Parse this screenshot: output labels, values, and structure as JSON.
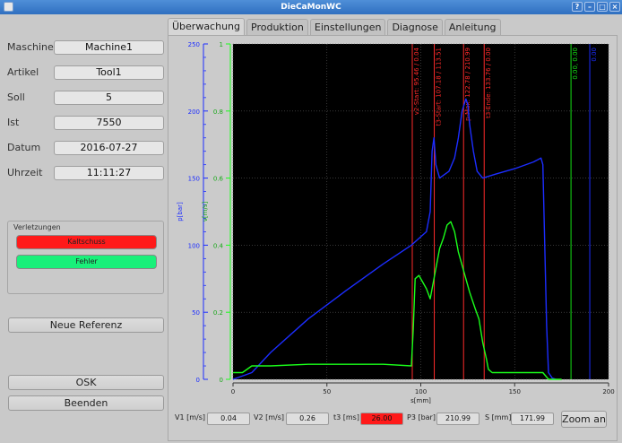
{
  "window": {
    "title": "DieCaMonWC",
    "buttons": [
      "?",
      "–",
      "□",
      "×"
    ]
  },
  "fields": [
    {
      "label": "Maschine",
      "value": "Machine1"
    },
    {
      "label": "Artikel",
      "value": "Tool1"
    },
    {
      "label": "Soll",
      "value": "5"
    },
    {
      "label": "Ist",
      "value": "7550"
    },
    {
      "label": "Datum",
      "value": "2016-07-27"
    },
    {
      "label": "Uhrzeit",
      "value": "11:11:27"
    }
  ],
  "violations": {
    "title": "Verletzungen",
    "items": [
      {
        "label": "Kaltschuss",
        "color": "#ff1a1a"
      },
      {
        "label": "Fehler",
        "color": "#19f07a"
      }
    ]
  },
  "buttons": {
    "reference": "Neue Referenz",
    "osk": "OSK",
    "quit": "Beenden",
    "zoom": "Zoom an"
  },
  "tabs": [
    {
      "label": "Überwachung",
      "active": true
    },
    {
      "label": "Produktion",
      "active": false
    },
    {
      "label": "Einstellungen",
      "active": false
    },
    {
      "label": "Diagnose",
      "active": false
    },
    {
      "label": "Anleitung",
      "active": false
    }
  ],
  "measurements": [
    {
      "label": "V1 [m/s]",
      "value": "0.04",
      "highlight": false
    },
    {
      "label": "V2 [m/s]",
      "value": "0.26",
      "highlight": false
    },
    {
      "label": "t3 [ms]",
      "value": "26.00",
      "highlight": true
    },
    {
      "label": "P3 [bar]",
      "value": "210.99",
      "highlight": false
    },
    {
      "label": "S [mm]",
      "value": "171.99",
      "highlight": false
    }
  ],
  "chart_data": {
    "type": "line",
    "background": "#000000",
    "xlabel": "s[mm]",
    "ylabel_left": "p[bar]",
    "ylabel_right": "v[m/s]",
    "xlim": [
      0,
      200
    ],
    "ylim_left": [
      0,
      250
    ],
    "ylim_right": [
      0,
      1
    ],
    "xticks": [
      "0",
      "50",
      "100",
      "150",
      "200"
    ],
    "yticks_left": [
      "0",
      "50",
      "100",
      "150",
      "200",
      "250"
    ],
    "yticks_right": [
      "0",
      "0.2",
      "0.4",
      "0.6",
      "0.8",
      "1"
    ],
    "grid": true,
    "series": [
      {
        "axis": "left",
        "color": "#1c2dff",
        "x": [
          0,
          10,
          20,
          40,
          60,
          80,
          95,
          103,
          105,
          106,
          107,
          108,
          109,
          110,
          112,
          115,
          118,
          120,
          122,
          124,
          125,
          126,
          128,
          130,
          133,
          140,
          150,
          160,
          164,
          165,
          166,
          167,
          168,
          170,
          172
        ],
        "y": [
          0,
          5,
          20,
          45,
          66,
          86,
          100,
          110,
          125,
          170,
          180,
          160,
          155,
          150,
          152,
          155,
          165,
          180,
          200,
          209,
          205,
          190,
          170,
          155,
          150,
          153,
          157,
          162,
          165,
          160,
          100,
          40,
          5,
          1,
          0
        ]
      },
      {
        "axis": "right",
        "color": "#1aff1a",
        "x": [
          0,
          5,
          10,
          20,
          40,
          60,
          80,
          95,
          96,
          97,
          99,
          101,
          103,
          105,
          107,
          110,
          112,
          114,
          116,
          118,
          120,
          123,
          126,
          129,
          131,
          133,
          135,
          136,
          138,
          140,
          145,
          150,
          155,
          160,
          165,
          168,
          170,
          175
        ],
        "y": [
          0.02,
          0.02,
          0.04,
          0.04,
          0.045,
          0.045,
          0.045,
          0.04,
          0.15,
          0.3,
          0.31,
          0.29,
          0.27,
          0.24,
          0.3,
          0.39,
          0.42,
          0.46,
          0.47,
          0.44,
          0.38,
          0.32,
          0.26,
          0.21,
          0.18,
          0.11,
          0.06,
          0.03,
          0.02,
          0.02,
          0.02,
          0.02,
          0.02,
          0.02,
          0.02,
          0.0,
          0.0,
          0.0
        ]
      }
    ],
    "markers": [
      {
        "x": 95.46,
        "color": "#ff2a2a",
        "label": "v2-Start: 95.46 / 0.04"
      },
      {
        "x": 107.18,
        "color": "#ff2a2a",
        "label": "t3-Start: 107.18 / 113.51"
      },
      {
        "x": 122.78,
        "color": "#ff2a2a",
        "label": "p-Max: 122.78 / 210.99"
      },
      {
        "x": 133.76,
        "color": "#ff2a2a",
        "label": "t3-Ende: 133.76 / 0.00"
      },
      {
        "x": 180.0,
        "color": "#14e014",
        "label": "0.00, 0.00"
      },
      {
        "x": 190.0,
        "color": "#1c2dff",
        "label": "0.00"
      }
    ]
  }
}
